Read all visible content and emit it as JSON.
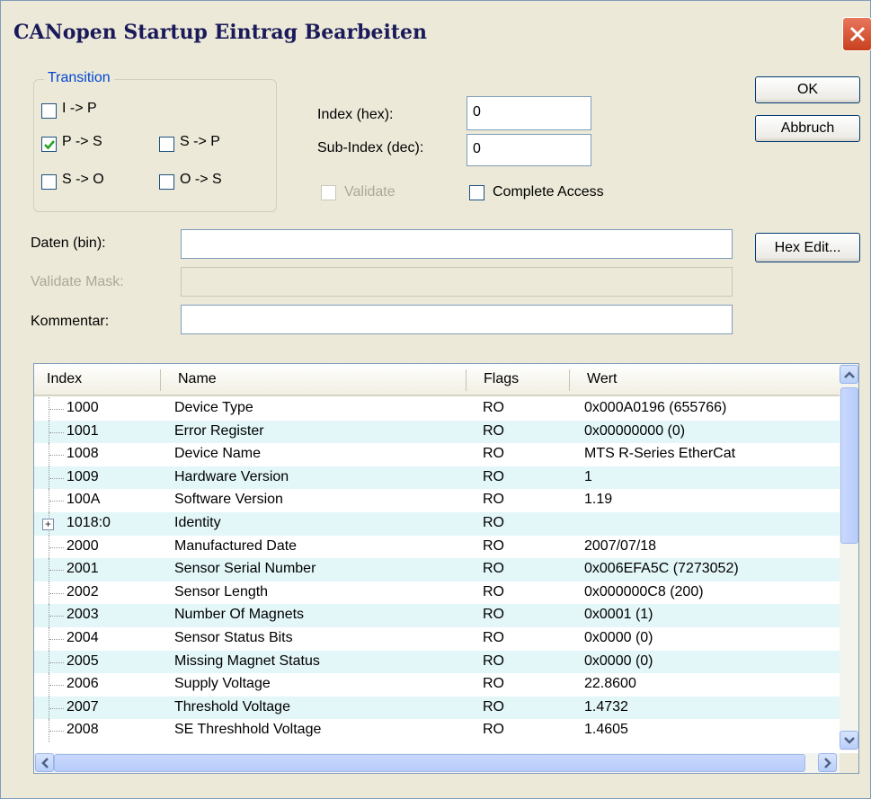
{
  "window": {
    "title": "CANopen Startup Eintrag Bearbeiten"
  },
  "transition": {
    "legend": "Transition",
    "items": [
      {
        "label": "I -> P",
        "checked": false
      },
      {
        "label": "P -> S",
        "checked": true
      },
      {
        "label": "S -> P",
        "checked": false
      },
      {
        "label": "S -> O",
        "checked": false
      },
      {
        "label": "O -> S",
        "checked": false
      }
    ]
  },
  "fields": {
    "index_label": "Index (hex):",
    "index_value": "0",
    "subindex_label": "Sub-Index (dec):",
    "subindex_value": "0",
    "validate_label": "Validate",
    "complete_access_label": "Complete Access",
    "data_label": "Daten (bin):",
    "data_value": "",
    "validate_mask_label": "Validate Mask:",
    "validate_mask_value": "",
    "comment_label": "Kommentar:",
    "comment_value": ""
  },
  "buttons": {
    "ok": "OK",
    "cancel": "Abbruch",
    "hex_edit": "Hex Edit..."
  },
  "table": {
    "columns": [
      "Index",
      "Name",
      "Flags",
      "Wert"
    ],
    "rows": [
      {
        "index": "1000",
        "name": "Device Type",
        "flags": "RO",
        "value": "0x000A0196 (655766)"
      },
      {
        "index": "1001",
        "name": "Error Register",
        "flags": "RO",
        "value": "0x00000000 (0)"
      },
      {
        "index": "1008",
        "name": "Device Name",
        "flags": "RO",
        "value": "MTS R-Series EtherCat"
      },
      {
        "index": "1009",
        "name": "Hardware Version",
        "flags": "RO",
        "value": "1"
      },
      {
        "index": "100A",
        "name": "Software Version",
        "flags": "RO",
        "value": "1.19"
      },
      {
        "index": "1018:0",
        "name": "Identity",
        "flags": "RO",
        "value": ""
      },
      {
        "index": "2000",
        "name": "Manufactured Date",
        "flags": "RO",
        "value": "2007/07/18"
      },
      {
        "index": "2001",
        "name": "Sensor Serial Number",
        "flags": "RO",
        "value": "0x006EFA5C (7273052)"
      },
      {
        "index": "2002",
        "name": "Sensor Length",
        "flags": "RO",
        "value": "0x000000C8 (200)"
      },
      {
        "index": "2003",
        "name": "Number Of Magnets",
        "flags": "RO",
        "value": "0x0001 (1)"
      },
      {
        "index": "2004",
        "name": "Sensor Status Bits",
        "flags": "RO",
        "value": "0x0000 (0)"
      },
      {
        "index": "2005",
        "name": "Missing Magnet Status",
        "flags": "RO",
        "value": "0x0000 (0)"
      },
      {
        "index": "2006",
        "name": "Supply Voltage",
        "flags": "RO",
        "value": "22.8600"
      },
      {
        "index": "2007",
        "name": "Threshold Voltage",
        "flags": "RO",
        "value": "1.4732"
      },
      {
        "index": "2008",
        "name": "SE Threshhold Voltage",
        "flags": "RO",
        "value": "1.4605"
      }
    ]
  }
}
